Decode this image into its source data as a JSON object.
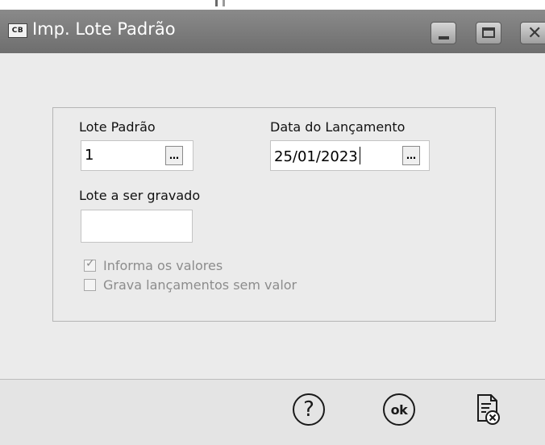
{
  "window": {
    "app_icon_text": "CB",
    "title": "Imp. Lote Padrão",
    "titlebar_color": "#7b7b7b",
    "controls": [
      "minimize-icon",
      "maximize-icon",
      "close-icon"
    ]
  },
  "form": {
    "lote_padrao": {
      "label": "Lote Padrão",
      "value": "1",
      "button_label": "…"
    },
    "data_lancamento": {
      "label": "Data do Lançamento",
      "value": "25/01/2023",
      "button_label": "…"
    },
    "lote_gravado": {
      "label": "Lote a ser gravado",
      "value": ""
    },
    "checkboxes": [
      {
        "label": "Informa os valores",
        "checked": true,
        "enabled": false
      },
      {
        "label": "Grava lançamentos sem valor",
        "checked": false,
        "enabled": false
      }
    ]
  },
  "footer": {
    "help_glyph": "?",
    "ok_label": "ok",
    "icons": [
      "help-icon",
      "ok-icon",
      "cancel-document-icon"
    ]
  }
}
